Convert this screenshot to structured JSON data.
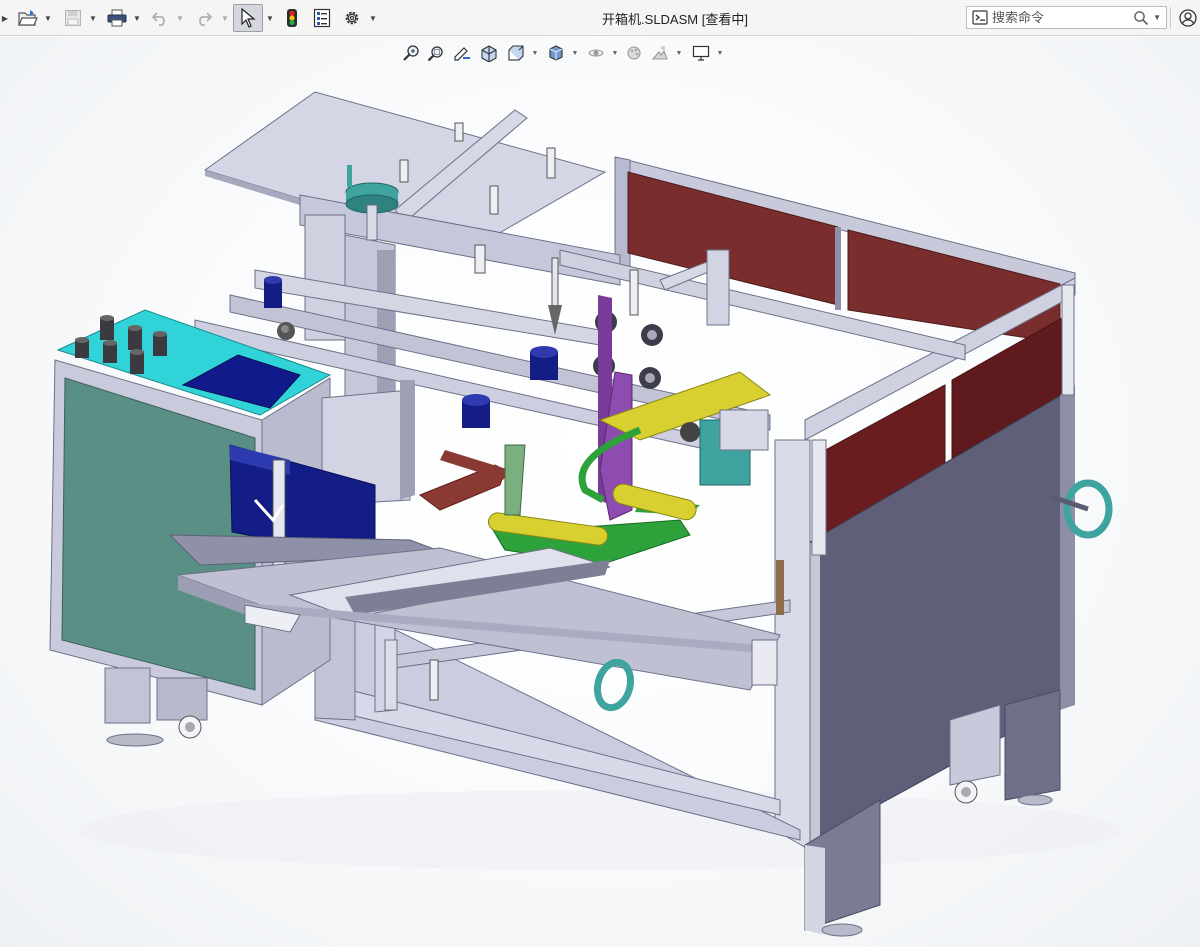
{
  "window": {
    "title": "开箱机.SLDASM [查看中]"
  },
  "toolbar": {
    "buttons": [
      {
        "name": "menu-toggle-icon",
        "active": false
      },
      {
        "name": "open-folder-icon",
        "active": false
      },
      {
        "name": "save-icon",
        "active": false,
        "disabled": true
      },
      {
        "name": "print-icon",
        "active": false
      },
      {
        "name": "undo-icon",
        "active": false,
        "disabled": true
      },
      {
        "name": "redo-icon",
        "active": false,
        "disabled": true
      },
      {
        "name": "select-arrow-icon",
        "active": true
      },
      {
        "name": "traffic-light-icon",
        "active": false
      },
      {
        "name": "file-properties-icon",
        "active": false
      },
      {
        "name": "gear-icon",
        "active": false
      }
    ]
  },
  "search": {
    "placeholder": "搜索命令"
  },
  "view_toolbar": {
    "items": [
      "zoom-to-fit-icon",
      "zoom-to-area-icon",
      "previous-view-icon",
      "section-view-icon",
      "view-orientation-icon",
      "display-style-icon",
      "hide-show-items-icon",
      "edit-appearance-icon",
      "apply-scene-icon",
      "view-settings-icon"
    ]
  },
  "colors": {
    "frame": "#c9cbdd",
    "frame_dark": "#7d7f97",
    "panel_red": "#7a2a2a",
    "panel_teal": "#5a8f86",
    "control_top": "#2fd3d8",
    "screen_blue": "#101a8a",
    "hopper_blue": "#141c86",
    "arm_green": "#2ea23a",
    "arm_yellow": "#d8d030",
    "flap_brown": "#8b3a33",
    "handwheel": "#3fa3a0"
  }
}
